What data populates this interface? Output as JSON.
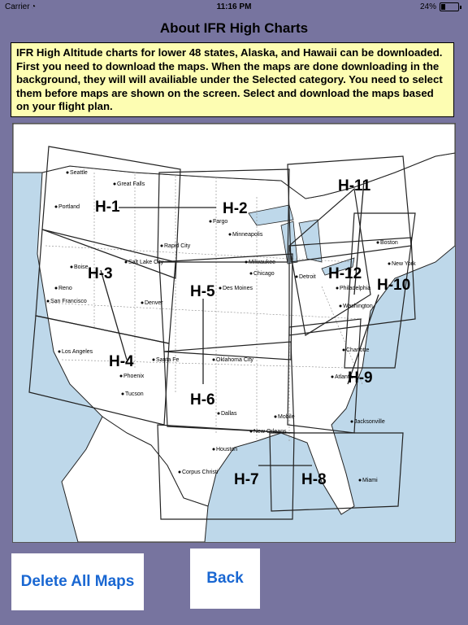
{
  "status": {
    "carrier": "Carrier",
    "time": "11:16 PM",
    "battery": "24%",
    "battery_level": 0.24
  },
  "header": {
    "title": "About IFR High Charts"
  },
  "info": {
    "text": "IFR High Altitude charts for lower 48 states, Alaska, and Hawaii can be downloaded.   First you need to download the maps.  When the maps are done downloading in the background, they will will availiable under the Selected category.  You need to select them before maps are shown on the screen.  Select and download the maps based on your flight plan."
  },
  "map": {
    "charts": [
      "H-1",
      "H-2",
      "H-3",
      "H-4",
      "H-5",
      "H-6",
      "H-7",
      "H-8",
      "H-9",
      "H-10",
      "H-11",
      "H-12"
    ],
    "cities": [
      "Seattle",
      "Great Falls",
      "Portland",
      "Fargo",
      "Minneapolis",
      "Rapid City",
      "Boise",
      "Salt Lake City",
      "Reno",
      "San Francisco",
      "Denver",
      "Des Moines",
      "Milwaukee",
      "Chicago",
      "Detroit",
      "Boston",
      "New York",
      "Philadelphia",
      "Washington",
      "Los Angeles",
      "Phoenix",
      "Tucson",
      "Santa Fe",
      "Oklahoma City",
      "Dallas",
      "Charlotte",
      "Atlanta",
      "Jacksonville",
      "Mobile",
      "New Orleans",
      "Houston",
      "Corpus Christi",
      "Miami"
    ]
  },
  "buttons": {
    "delete_all": "Delete All Maps",
    "back": "Back"
  },
  "colors": {
    "background": "#77749f",
    "info_bg": "#fdfdb2",
    "button_text": "#1967d2",
    "water": "#bed8ea",
    "land": "#ffffff"
  }
}
